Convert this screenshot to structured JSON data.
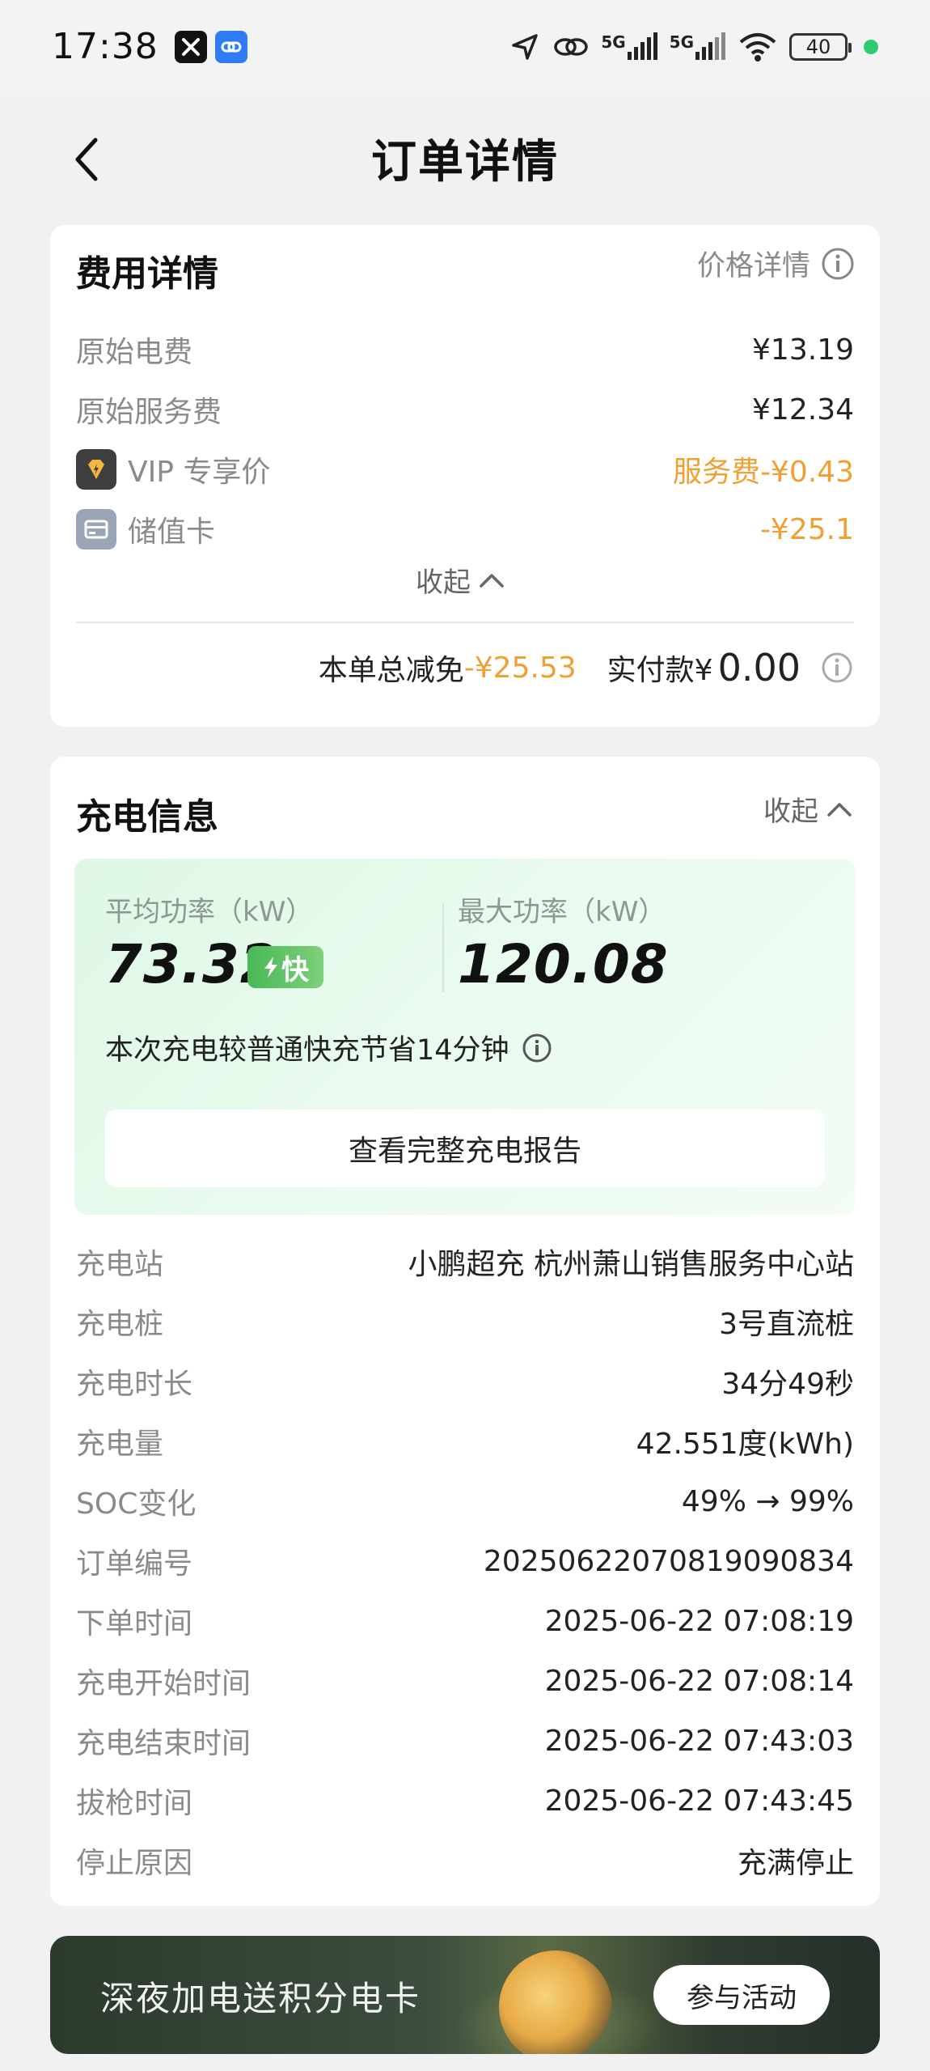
{
  "status_bar": {
    "time": "17:38",
    "signal1": "5G",
    "signal2": "5G",
    "battery": "40"
  },
  "header": {
    "title": "订单详情"
  },
  "fee_card": {
    "title": "费用详情",
    "price_detail_link": "价格详情",
    "rows": [
      {
        "label": "原始电费",
        "value": "¥13.19"
      },
      {
        "label": "原始服务费",
        "value": "¥12.34"
      },
      {
        "label": "VIP 专享价",
        "value": "服务费-¥0.43"
      },
      {
        "label": "储值卡",
        "value": "-¥25.1"
      }
    ],
    "collapse_label": "收起",
    "total_discount_label": "本单总减免",
    "total_discount_value": "-¥25.53",
    "paid_label": "实付款¥",
    "paid_value": "0.00"
  },
  "charge_card": {
    "title": "充电信息",
    "collapse_label": "收起",
    "avg_power_label": "平均功率（kW）",
    "avg_power_value": "73.32",
    "fast_badge": "快",
    "max_power_label": "最大功率（kW）",
    "max_power_value": "120.08",
    "save_text": "本次充电较普通快充节省14分钟",
    "report_button": "查看完整充电报告",
    "rows": [
      {
        "label": "充电站",
        "value": "小鹏超充 杭州萧山销售服务中心站"
      },
      {
        "label": "充电桩",
        "value": "3号直流桩"
      },
      {
        "label": "充电时长",
        "value": "34分49秒"
      },
      {
        "label": "充电量",
        "value": "42.551度(kWh)"
      },
      {
        "label": "SOC变化",
        "value": "49% → 99%"
      },
      {
        "label": "订单编号",
        "value": "20250622070819090834"
      },
      {
        "label": "下单时间",
        "value": "2025-06-22 07:08:19"
      },
      {
        "label": "充电开始时间",
        "value": "2025-06-22 07:08:14"
      },
      {
        "label": "充电结束时间",
        "value": "2025-06-22 07:43:03"
      },
      {
        "label": "拔枪时间",
        "value": "2025-06-22 07:43:45"
      },
      {
        "label": "停止原因",
        "value": "充满停止"
      }
    ]
  },
  "banner": {
    "text": "深夜加电送积分电卡",
    "button": "参与活动"
  },
  "colors": {
    "accent_orange": "#f0a032",
    "fast_green": "#49b857",
    "page_bg": "#f1f1f1"
  }
}
